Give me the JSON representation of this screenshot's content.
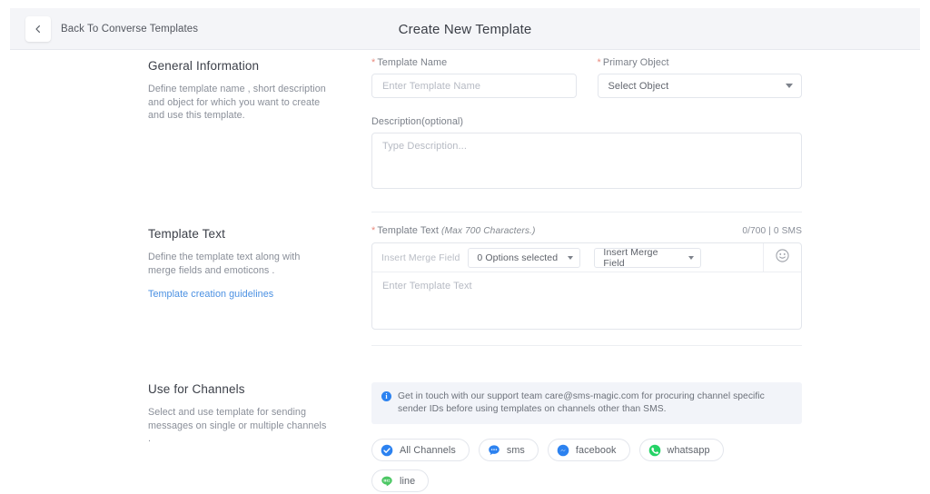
{
  "header": {
    "back_label": "Back To Converse Templates",
    "title": "Create New Template",
    "back_icon": "chevron-left-icon"
  },
  "sections": {
    "general": {
      "title": "General Information",
      "description": "Define template name , short description and object for which you want to create and use this template.",
      "fields": {
        "template_name": {
          "label": "Template Name",
          "required_marker": "*",
          "placeholder": "Enter Template Name",
          "value": ""
        },
        "primary_object": {
          "label": "Primary Object",
          "required_marker": "*",
          "selected": "Select Object",
          "caret_icon": "chevron-down-icon"
        },
        "description": {
          "label": "Description(optional)",
          "placeholder": "Type Description...",
          "value": ""
        }
      }
    },
    "template_text": {
      "title": "Template Text",
      "description": "Define the template text along with merge fields and emoticons .",
      "link": "Template creation guidelines",
      "field_label": "Template Text",
      "required_marker": "*",
      "max_chars_note": "(Max 700 Characters.)",
      "counter": "0/700  |  0 SMS",
      "toolbar": {
        "insert_merge_field_label": "Insert Merge Field",
        "options_select": "0 Options selected",
        "merge_field_select": "Insert Merge Field",
        "emoji_icon": "emoji-smiley-icon",
        "caret_icon": "chevron-down-icon"
      },
      "editor_placeholder": "Enter Template Text",
      "editor_value": ""
    },
    "channels": {
      "title": "Use for Channels",
      "description": "Select and use template for sending messages on single or multiple channels .",
      "banner": {
        "icon": "info-icon",
        "text": "Get in touch with our support team care@sms-magic.com for procuring channel specific sender IDs before using templates on channels other than SMS."
      },
      "chips": [
        {
          "label": "All Channels",
          "icon": "check-circle-icon",
          "color": "#2c82f0",
          "selected": true
        },
        {
          "label": "sms",
          "icon": "sms-chat-icon",
          "color": "#2c82f0",
          "selected": false
        },
        {
          "label": "facebook",
          "icon": "facebook-messenger-icon",
          "color": "#2c82f0",
          "selected": false
        },
        {
          "label": "whatsapp",
          "icon": "whatsapp-icon",
          "color": "#25d366",
          "selected": false
        },
        {
          "label": "line",
          "icon": "line-icon",
          "color": "#4cc764",
          "selected": false
        }
      ]
    }
  }
}
